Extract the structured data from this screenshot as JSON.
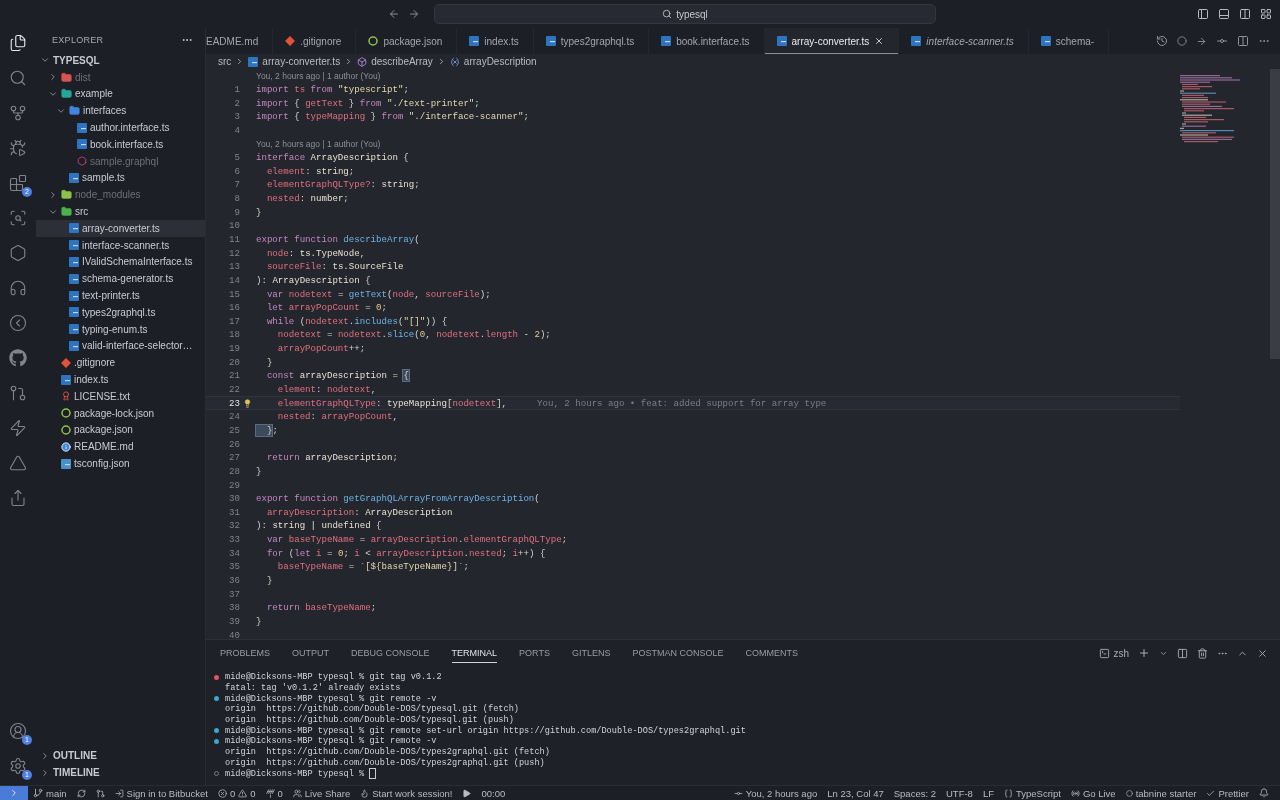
{
  "title_bar": {
    "search": "typesql"
  },
  "activity_bar": {
    "extensions_badge": "2",
    "accounts_badge": "1",
    "settings_badge": "1"
  },
  "explorer": {
    "title": "EXPLORER",
    "root": {
      "label": "TYPESQL",
      "expanded": true,
      "children": [
        {
          "label": "dist",
          "kind": "folder-dist",
          "expanded": false,
          "ignored": true,
          "selected": false
        },
        {
          "label": "example",
          "kind": "folder-example",
          "expanded": true,
          "ignored": false,
          "selected": false,
          "children": [
            {
              "label": "interfaces",
              "kind": "folder-interfaces",
              "expanded": true,
              "ignored": false,
              "selected": false,
              "children": [
                {
                  "label": "author.interface.ts",
                  "kind": "ts",
                  "ignored": false,
                  "selected": false
                },
                {
                  "label": "book.interface.ts",
                  "kind": "ts",
                  "ignored": false,
                  "selected": false
                },
                {
                  "label": "sample.graphql",
                  "kind": "graphql",
                  "ignored": true,
                  "selected": false
                }
              ]
            },
            {
              "label": "sample.ts",
              "kind": "ts",
              "ignored": false,
              "selected": false
            }
          ]
        },
        {
          "label": "node_modules",
          "kind": "folder-node",
          "expanded": false,
          "ignored": true,
          "selected": false
        },
        {
          "label": "src",
          "kind": "folder-src",
          "expanded": true,
          "ignored": false,
          "selected": false,
          "children": [
            {
              "label": "array-converter.ts",
              "kind": "ts",
              "ignored": false,
              "selected": true
            },
            {
              "label": "interface-scanner.ts",
              "kind": "ts",
              "ignored": false,
              "selected": false
            },
            {
              "label": "IValidSchemaInterface.ts",
              "kind": "ts",
              "ignored": false,
              "selected": false
            },
            {
              "label": "schema-generator.ts",
              "kind": "ts",
              "ignored": false,
              "selected": false
            },
            {
              "label": "text-printer.ts",
              "kind": "ts",
              "ignored": false,
              "selected": false
            },
            {
              "label": "types2graphql.ts",
              "kind": "ts",
              "ignored": false,
              "selected": false
            },
            {
              "label": "typing-enum.ts",
              "kind": "ts",
              "ignored": false,
              "selected": false
            },
            {
              "label": "valid-interface-selector…",
              "kind": "ts",
              "ignored": false,
              "selected": false
            }
          ]
        },
        {
          "label": ".gitignore",
          "kind": "git",
          "ignored": false,
          "selected": false
        },
        {
          "label": "index.ts",
          "kind": "ts",
          "ignored": false,
          "selected": false
        },
        {
          "label": "LICENSE.txt",
          "kind": "license",
          "ignored": false,
          "selected": false
        },
        {
          "label": "package-lock.json",
          "kind": "json",
          "ignored": false,
          "selected": false
        },
        {
          "label": "package.json",
          "kind": "json",
          "ignored": false,
          "selected": false
        },
        {
          "label": "README.md",
          "kind": "info",
          "ignored": false,
          "selected": false
        },
        {
          "label": "tsconfig.json",
          "kind": "tsconfig",
          "ignored": false,
          "selected": false
        }
      ]
    },
    "sections": [
      {
        "label": "OUTLINE",
        "expanded": false
      },
      {
        "label": "TIMELINE",
        "expanded": false
      }
    ]
  },
  "tabs": [
    {
      "label": "EADME.md",
      "kind": "plain",
      "selected": false,
      "preview": false
    },
    {
      "label": ".gitignore",
      "kind": "git",
      "selected": false,
      "preview": false
    },
    {
      "label": "package.json",
      "kind": "json",
      "selected": false,
      "preview": false
    },
    {
      "label": "index.ts",
      "kind": "ts",
      "selected": false,
      "preview": false
    },
    {
      "label": "types2graphql.ts",
      "kind": "ts",
      "selected": false,
      "preview": false
    },
    {
      "label": "book.interface.ts",
      "kind": "ts",
      "selected": false,
      "preview": false
    },
    {
      "label": "array-converter.ts",
      "kind": "ts",
      "selected": true,
      "preview": false
    },
    {
      "label": "interface-scanner.ts",
      "kind": "ts",
      "selected": false,
      "preview": true
    },
    {
      "label": "schema-",
      "kind": "ts",
      "selected": false,
      "preview": false
    }
  ],
  "breadcrumbs": [
    "src",
    "array-converter.ts",
    "describeArray",
    "arrayDescription"
  ],
  "editor": {
    "rows": [
      {
        "kind": "lens",
        "text": "You, 2 hours ago | 1 author (You)"
      },
      {
        "kind": "code",
        "number": "1",
        "tokens": [
          {
            "kind": "keyword",
            "text": "import "
          },
          {
            "kind": "variable",
            "text": "ts "
          },
          {
            "kind": "keyword",
            "text": "from "
          },
          {
            "kind": "string",
            "text": "\"typescript\""
          },
          {
            "kind": "plain",
            "text": ";"
          }
        ]
      },
      {
        "kind": "code",
        "number": "2",
        "tokens": [
          {
            "kind": "keyword",
            "text": "import "
          },
          {
            "kind": "plain",
            "text": "{ "
          },
          {
            "kind": "variable",
            "text": "getText"
          },
          {
            "kind": "plain",
            "text": " } "
          },
          {
            "kind": "keyword",
            "text": "from "
          },
          {
            "kind": "string",
            "text": "\"./text-printer\""
          },
          {
            "kind": "plain",
            "text": ";"
          }
        ]
      },
      {
        "kind": "code",
        "number": "3",
        "tokens": [
          {
            "kind": "keyword",
            "text": "import "
          },
          {
            "kind": "plain",
            "text": "{ "
          },
          {
            "kind": "variable",
            "text": "typeMapping"
          },
          {
            "kind": "plain",
            "text": " } "
          },
          {
            "kind": "keyword",
            "text": "from "
          },
          {
            "kind": "string",
            "text": "\"./interface-scanner\""
          },
          {
            "kind": "plain",
            "text": ";"
          }
        ]
      },
      {
        "kind": "code",
        "number": "4",
        "tokens": []
      },
      {
        "kind": "lens",
        "text": "You, 2 hours ago | 1 author (You)"
      },
      {
        "kind": "code",
        "number": "5",
        "tokens": [
          {
            "kind": "keyword",
            "text": "interface "
          },
          {
            "kind": "type",
            "text": "ArrayDescription"
          },
          {
            "kind": "plain",
            "text": " {"
          }
        ]
      },
      {
        "kind": "code",
        "number": "6",
        "tokens": [
          {
            "kind": "variable",
            "text": "  element"
          },
          {
            "kind": "plain",
            "text": ": "
          },
          {
            "kind": "type",
            "text": "string"
          },
          {
            "kind": "plain",
            "text": ";"
          }
        ]
      },
      {
        "kind": "code",
        "number": "7",
        "tokens": [
          {
            "kind": "variable",
            "text": "  elementGraphQLType?"
          },
          {
            "kind": "plain",
            "text": ": "
          },
          {
            "kind": "type",
            "text": "string"
          },
          {
            "kind": "plain",
            "text": ";"
          }
        ]
      },
      {
        "kind": "code",
        "number": "8",
        "tokens": [
          {
            "kind": "variable",
            "text": "  nested"
          },
          {
            "kind": "plain",
            "text": ": "
          },
          {
            "kind": "type",
            "text": "number"
          },
          {
            "kind": "plain",
            "text": ";"
          }
        ]
      },
      {
        "kind": "code",
        "number": "9",
        "tokens": [
          {
            "kind": "plain",
            "text": "}"
          }
        ]
      },
      {
        "kind": "code",
        "number": "10",
        "tokens": []
      },
      {
        "kind": "code",
        "number": "11",
        "tokens": [
          {
            "kind": "keyword",
            "text": "export function "
          },
          {
            "kind": "function",
            "text": "describeArray"
          },
          {
            "kind": "plain",
            "text": "("
          }
        ]
      },
      {
        "kind": "code",
        "number": "12",
        "tokens": [
          {
            "kind": "variable",
            "text": "  node"
          },
          {
            "kind": "plain",
            "text": ": "
          },
          {
            "kind": "type",
            "text": "ts.TypeNode"
          },
          {
            "kind": "plain",
            "text": ","
          }
        ]
      },
      {
        "kind": "code",
        "number": "13",
        "tokens": [
          {
            "kind": "variable",
            "text": "  sourceFile"
          },
          {
            "kind": "plain",
            "text": ": "
          },
          {
            "kind": "type",
            "text": "ts.SourceFile"
          }
        ]
      },
      {
        "kind": "code",
        "number": "14",
        "tokens": [
          {
            "kind": "plain",
            "text": "): "
          },
          {
            "kind": "type",
            "text": "ArrayDescription"
          },
          {
            "kind": "plain",
            "text": " {"
          }
        ]
      },
      {
        "kind": "code",
        "number": "15",
        "tokens": [
          {
            "kind": "keyword",
            "text": "  var "
          },
          {
            "kind": "variable",
            "text": "nodetext"
          },
          {
            "kind": "plain",
            "text": " = "
          },
          {
            "kind": "function",
            "text": "getText"
          },
          {
            "kind": "plain",
            "text": "("
          },
          {
            "kind": "variable",
            "text": "node"
          },
          {
            "kind": "plain",
            "text": ", "
          },
          {
            "kind": "variable",
            "text": "sourceFile"
          },
          {
            "kind": "plain",
            "text": ");"
          }
        ]
      },
      {
        "kind": "code",
        "number": "16",
        "tokens": [
          {
            "kind": "keyword",
            "text": "  let "
          },
          {
            "kind": "variable",
            "text": "arrayPopCount"
          },
          {
            "kind": "plain",
            "text": " = "
          },
          {
            "kind": "number",
            "text": "0"
          },
          {
            "kind": "plain",
            "text": ";"
          }
        ]
      },
      {
        "kind": "code",
        "number": "17",
        "tokens": [
          {
            "kind": "keyword",
            "text": "  while "
          },
          {
            "kind": "plain",
            "text": "("
          },
          {
            "kind": "variable",
            "text": "nodetext"
          },
          {
            "kind": "plain",
            "text": "."
          },
          {
            "kind": "function",
            "text": "includes"
          },
          {
            "kind": "plain",
            "text": "("
          },
          {
            "kind": "string",
            "text": "\"[]\""
          },
          {
            "kind": "plain",
            "text": ")) {"
          }
        ]
      },
      {
        "kind": "code",
        "number": "18",
        "tokens": [
          {
            "kind": "variable",
            "text": "    nodetext"
          },
          {
            "kind": "plain",
            "text": " = "
          },
          {
            "kind": "variable",
            "text": "nodetext"
          },
          {
            "kind": "plain",
            "text": "."
          },
          {
            "kind": "function",
            "text": "slice"
          },
          {
            "kind": "plain",
            "text": "("
          },
          {
            "kind": "number",
            "text": "0"
          },
          {
            "kind": "plain",
            "text": ", "
          },
          {
            "kind": "variable",
            "text": "nodetext"
          },
          {
            "kind": "plain",
            "text": "."
          },
          {
            "kind": "variable",
            "text": "length"
          },
          {
            "kind": "plain",
            "text": " - "
          },
          {
            "kind": "number",
            "text": "2"
          },
          {
            "kind": "plain",
            "text": ");"
          }
        ]
      },
      {
        "kind": "code",
        "number": "19",
        "tokens": [
          {
            "kind": "variable",
            "text": "    arrayPopCount"
          },
          {
            "kind": "plain",
            "text": "++;"
          }
        ]
      },
      {
        "kind": "code",
        "number": "20",
        "tokens": [
          {
            "kind": "plain",
            "text": "  }"
          }
        ]
      },
      {
        "kind": "code",
        "number": "21",
        "tokens": [
          {
            "kind": "keyword",
            "text": "  const "
          },
          {
            "kind": "type",
            "text": "arrayDescription"
          },
          {
            "kind": "plain",
            "text": " = "
          },
          {
            "kind": "bracket",
            "text": "{"
          }
        ]
      },
      {
        "kind": "code",
        "number": "22",
        "tokens": [
          {
            "kind": "variable",
            "text": "    element"
          },
          {
            "kind": "plain",
            "text": ": "
          },
          {
            "kind": "variable",
            "text": "nodetext"
          },
          {
            "kind": "plain",
            "text": ","
          }
        ]
      },
      {
        "kind": "code",
        "number": "23",
        "current": true,
        "bulb": true,
        "blame": "You, 2 hours ago • feat: added support for array type",
        "tokens": [
          {
            "kind": "variable",
            "text": "    elementGraphQLType"
          },
          {
            "kind": "plain",
            "text": ": "
          },
          {
            "kind": "type",
            "text": "typeMapping"
          },
          {
            "kind": "plain",
            "text": "["
          },
          {
            "kind": "variable",
            "text": "nodetext"
          },
          {
            "kind": "plain",
            "text": "],"
          }
        ]
      },
      {
        "kind": "code",
        "number": "24",
        "tokens": [
          {
            "kind": "variable",
            "text": "    nested"
          },
          {
            "kind": "plain",
            "text": ": "
          },
          {
            "kind": "variable",
            "text": "arrayPopCount"
          },
          {
            "kind": "plain",
            "text": ","
          }
        ]
      },
      {
        "kind": "code",
        "number": "25",
        "tokens": [
          {
            "kind": "bracket",
            "text": "  }"
          },
          {
            "kind": "plain",
            "text": ";"
          }
        ]
      },
      {
        "kind": "code",
        "number": "26",
        "tokens": []
      },
      {
        "kind": "code",
        "number": "27",
        "tokens": [
          {
            "kind": "keyword",
            "text": "  return "
          },
          {
            "kind": "type",
            "text": "arrayDescription"
          },
          {
            "kind": "plain",
            "text": ";"
          }
        ]
      },
      {
        "kind": "code",
        "number": "28",
        "tokens": [
          {
            "kind": "plain",
            "text": "}"
          }
        ]
      },
      {
        "kind": "code",
        "number": "29",
        "tokens": []
      },
      {
        "kind": "code",
        "number": "30",
        "tokens": [
          {
            "kind": "keyword",
            "text": "export function "
          },
          {
            "kind": "function",
            "text": "getGraphQLArrayFromArrayDescription"
          },
          {
            "kind": "plain",
            "text": "("
          }
        ]
      },
      {
        "kind": "code",
        "number": "31",
        "tokens": [
          {
            "kind": "variable",
            "text": "  arrayDescription"
          },
          {
            "kind": "plain",
            "text": ": "
          },
          {
            "kind": "type",
            "text": "ArrayDescription"
          }
        ]
      },
      {
        "kind": "code",
        "number": "32",
        "tokens": [
          {
            "kind": "plain",
            "text": "): "
          },
          {
            "kind": "type",
            "text": "string | undefined"
          },
          {
            "kind": "plain",
            "text": " {"
          }
        ]
      },
      {
        "kind": "code",
        "number": "33",
        "tokens": [
          {
            "kind": "keyword",
            "text": "  var "
          },
          {
            "kind": "variable",
            "text": "baseTypeName"
          },
          {
            "kind": "plain",
            "text": " = "
          },
          {
            "kind": "variable",
            "text": "arrayDescription"
          },
          {
            "kind": "plain",
            "text": "."
          },
          {
            "kind": "variable",
            "text": "elementGraphQLType"
          },
          {
            "kind": "plain",
            "text": ";"
          }
        ]
      },
      {
        "kind": "code",
        "number": "34",
        "tokens": [
          {
            "kind": "keyword",
            "text": "  for "
          },
          {
            "kind": "plain",
            "text": "("
          },
          {
            "kind": "keyword",
            "text": "let "
          },
          {
            "kind": "variable",
            "text": "i"
          },
          {
            "kind": "plain",
            "text": " = "
          },
          {
            "kind": "number",
            "text": "0"
          },
          {
            "kind": "plain",
            "text": "; "
          },
          {
            "kind": "variable",
            "text": "i"
          },
          {
            "kind": "plain",
            "text": " < "
          },
          {
            "kind": "variable",
            "text": "arrayDescription"
          },
          {
            "kind": "plain",
            "text": "."
          },
          {
            "kind": "variable",
            "text": "nested"
          },
          {
            "kind": "plain",
            "text": "; "
          },
          {
            "kind": "variable",
            "text": "i"
          },
          {
            "kind": "plain",
            "text": "++) {"
          }
        ]
      },
      {
        "kind": "code",
        "number": "35",
        "tokens": [
          {
            "kind": "variable",
            "text": "    baseTypeName"
          },
          {
            "kind": "plain",
            "text": " = "
          },
          {
            "kind": "string",
            "text": "`[${baseTypeName}]`"
          },
          {
            "kind": "plain",
            "text": ";"
          }
        ]
      },
      {
        "kind": "code",
        "number": "36",
        "tokens": [
          {
            "kind": "plain",
            "text": "  }"
          }
        ]
      },
      {
        "kind": "code",
        "number": "37",
        "tokens": []
      },
      {
        "kind": "code",
        "number": "38",
        "tokens": [
          {
            "kind": "keyword",
            "text": "  return "
          },
          {
            "kind": "variable",
            "text": "baseTypeName"
          },
          {
            "kind": "plain",
            "text": ";"
          }
        ]
      },
      {
        "kind": "code",
        "number": "39",
        "tokens": [
          {
            "kind": "plain",
            "text": "}"
          }
        ]
      },
      {
        "kind": "code",
        "number": "40",
        "tokens": []
      }
    ]
  },
  "panel": {
    "tabs": [
      {
        "label": "PROBLEMS",
        "selected": false
      },
      {
        "label": "OUTPUT",
        "selected": false
      },
      {
        "label": "DEBUG CONSOLE",
        "selected": false
      },
      {
        "label": "TERMINAL",
        "selected": true
      },
      {
        "label": "PORTS",
        "selected": false
      },
      {
        "label": "GITLENS",
        "selected": false
      },
      {
        "label": "POSTMAN CONSOLE",
        "selected": false
      },
      {
        "label": "COMMENTS",
        "selected": false
      }
    ],
    "shell": "zsh",
    "lines": [
      {
        "kind": "error",
        "text": "mide@Dicksons-MBP typesql % git tag v0.1.2"
      },
      {
        "kind": "output",
        "text": "fatal: tag 'v0.1.2' already exists"
      },
      {
        "kind": "ok",
        "text": "mide@Dicksons-MBP typesql % git remote -v"
      },
      {
        "kind": "output",
        "text": "origin  https://github.com/Double-DOS/typesql.git (fetch)"
      },
      {
        "kind": "output",
        "text": "origin  https://github.com/Double-DOS/typesql.git (push)"
      },
      {
        "kind": "ok",
        "text": "mide@Dicksons-MBP typesql % git remote set-url origin https://github.com/Double-DOS/types2graphql.git"
      },
      {
        "kind": "ok",
        "text": "mide@Dicksons-MBP typesql % git remote -v"
      },
      {
        "kind": "output",
        "text": "origin  https://github.com/Double-DOS/types2graphql.git (fetch)"
      },
      {
        "kind": "output",
        "text": "origin  https://github.com/Double-DOS/types2graphql.git (push)"
      },
      {
        "kind": "idle",
        "text": "mide@Dicksons-MBP typesql % ",
        "cursor": true
      }
    ]
  },
  "status_bar": {
    "branch": "main",
    "bitbucket": "Sign in to Bitbucket",
    "errors": "0",
    "warnings": "0",
    "ports": "0",
    "live_share": "Live Share",
    "work_session": "Start work session!",
    "timer": "00:00",
    "blame": "You, 2 hours ago",
    "position": "Ln 23, Col 47",
    "indent": "Spaces: 2",
    "encoding": "UTF-8",
    "eol": "LF",
    "language": "TypeScript",
    "go_live": "Go Live",
    "tabnine": "tabnine starter",
    "prettier": "Prettier"
  }
}
